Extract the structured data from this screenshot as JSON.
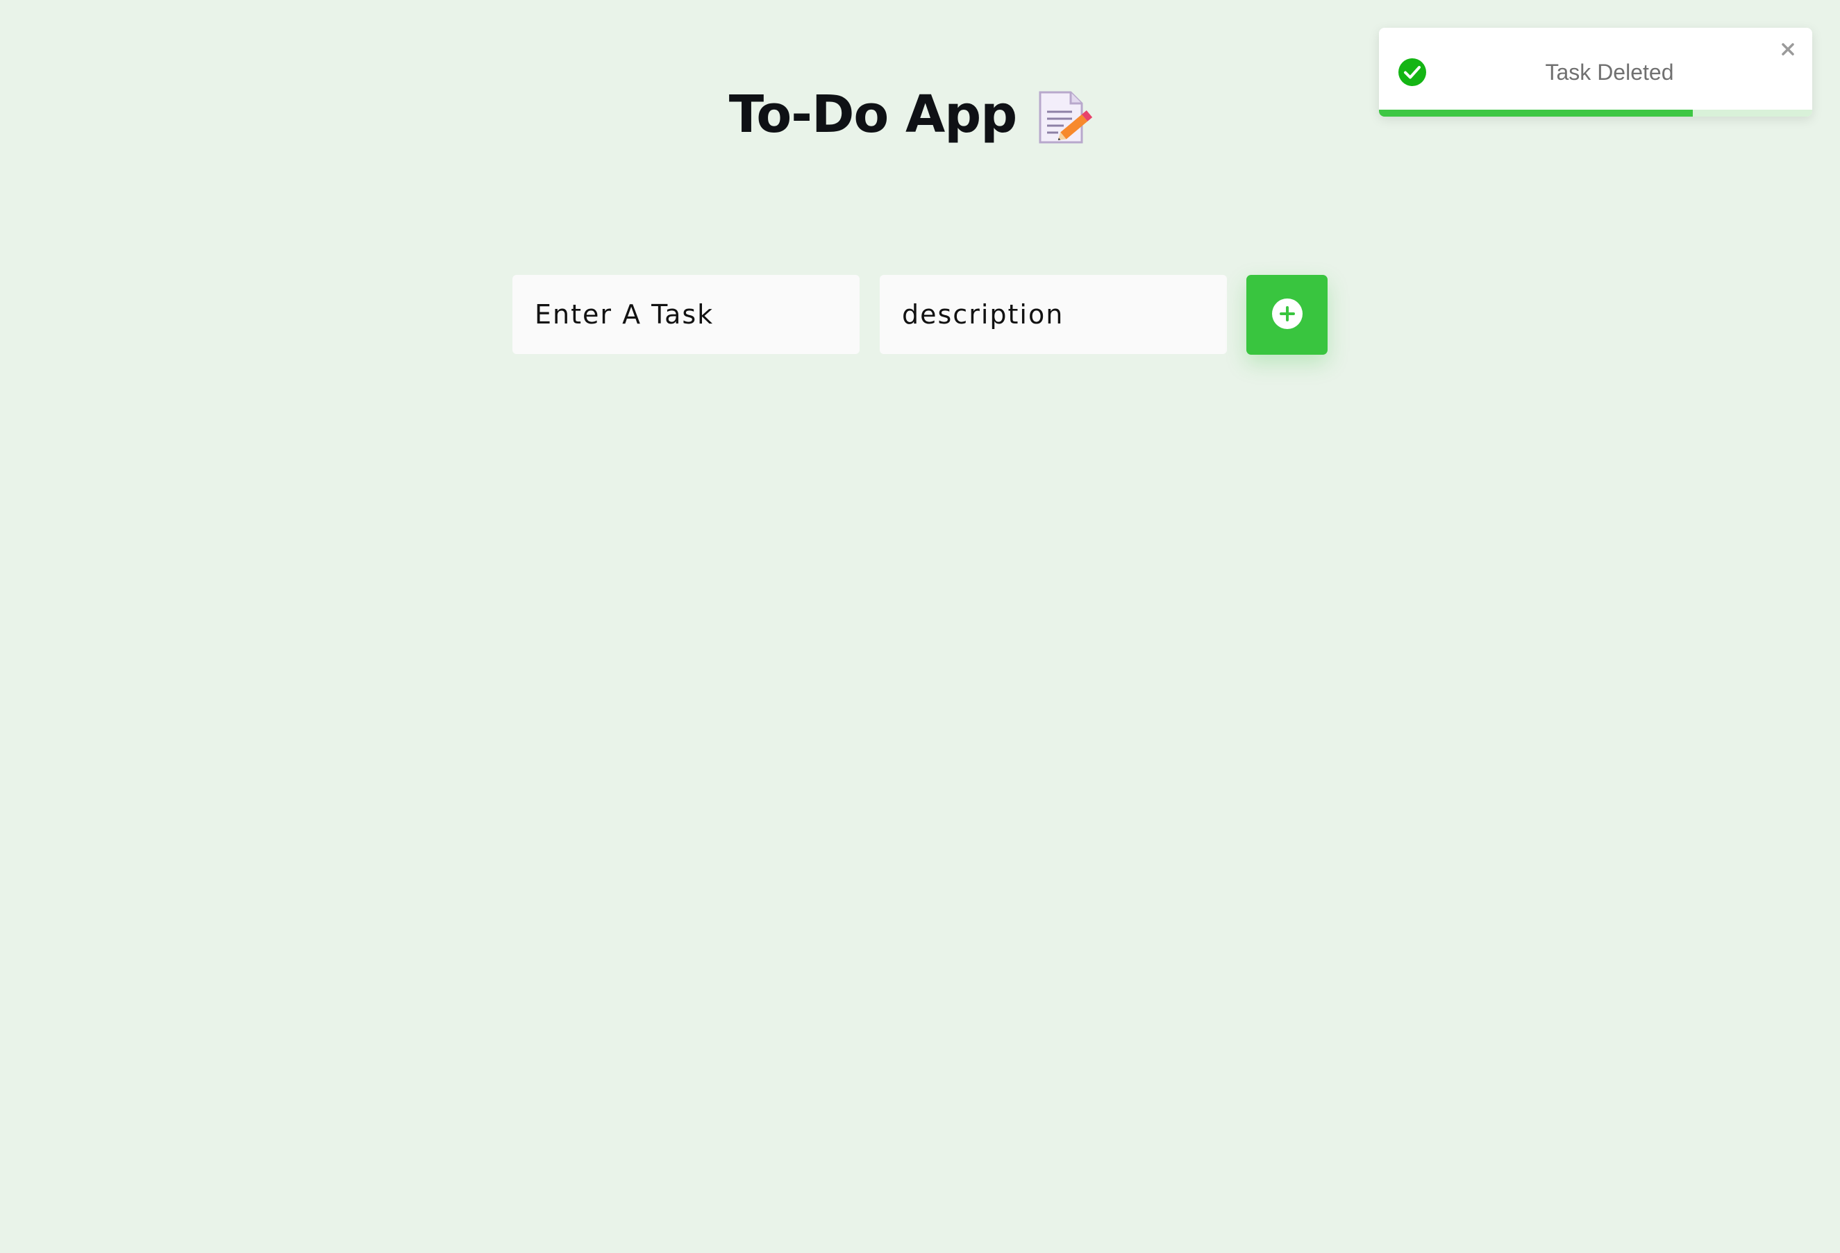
{
  "app": {
    "title": "To-Do App"
  },
  "form": {
    "task_placeholder": "Enter A Task",
    "description_placeholder": "description",
    "add_button_label": "+"
  },
  "toast": {
    "message": "Task Deleted",
    "status": "success",
    "progress_fraction": 0.725,
    "close_icon": "close-icon",
    "status_icon": "check-circle-icon"
  },
  "colors": {
    "background": "#e9f3e9",
    "accent": "#39c53f",
    "success": "#14b514",
    "toast_text": "#707070"
  }
}
